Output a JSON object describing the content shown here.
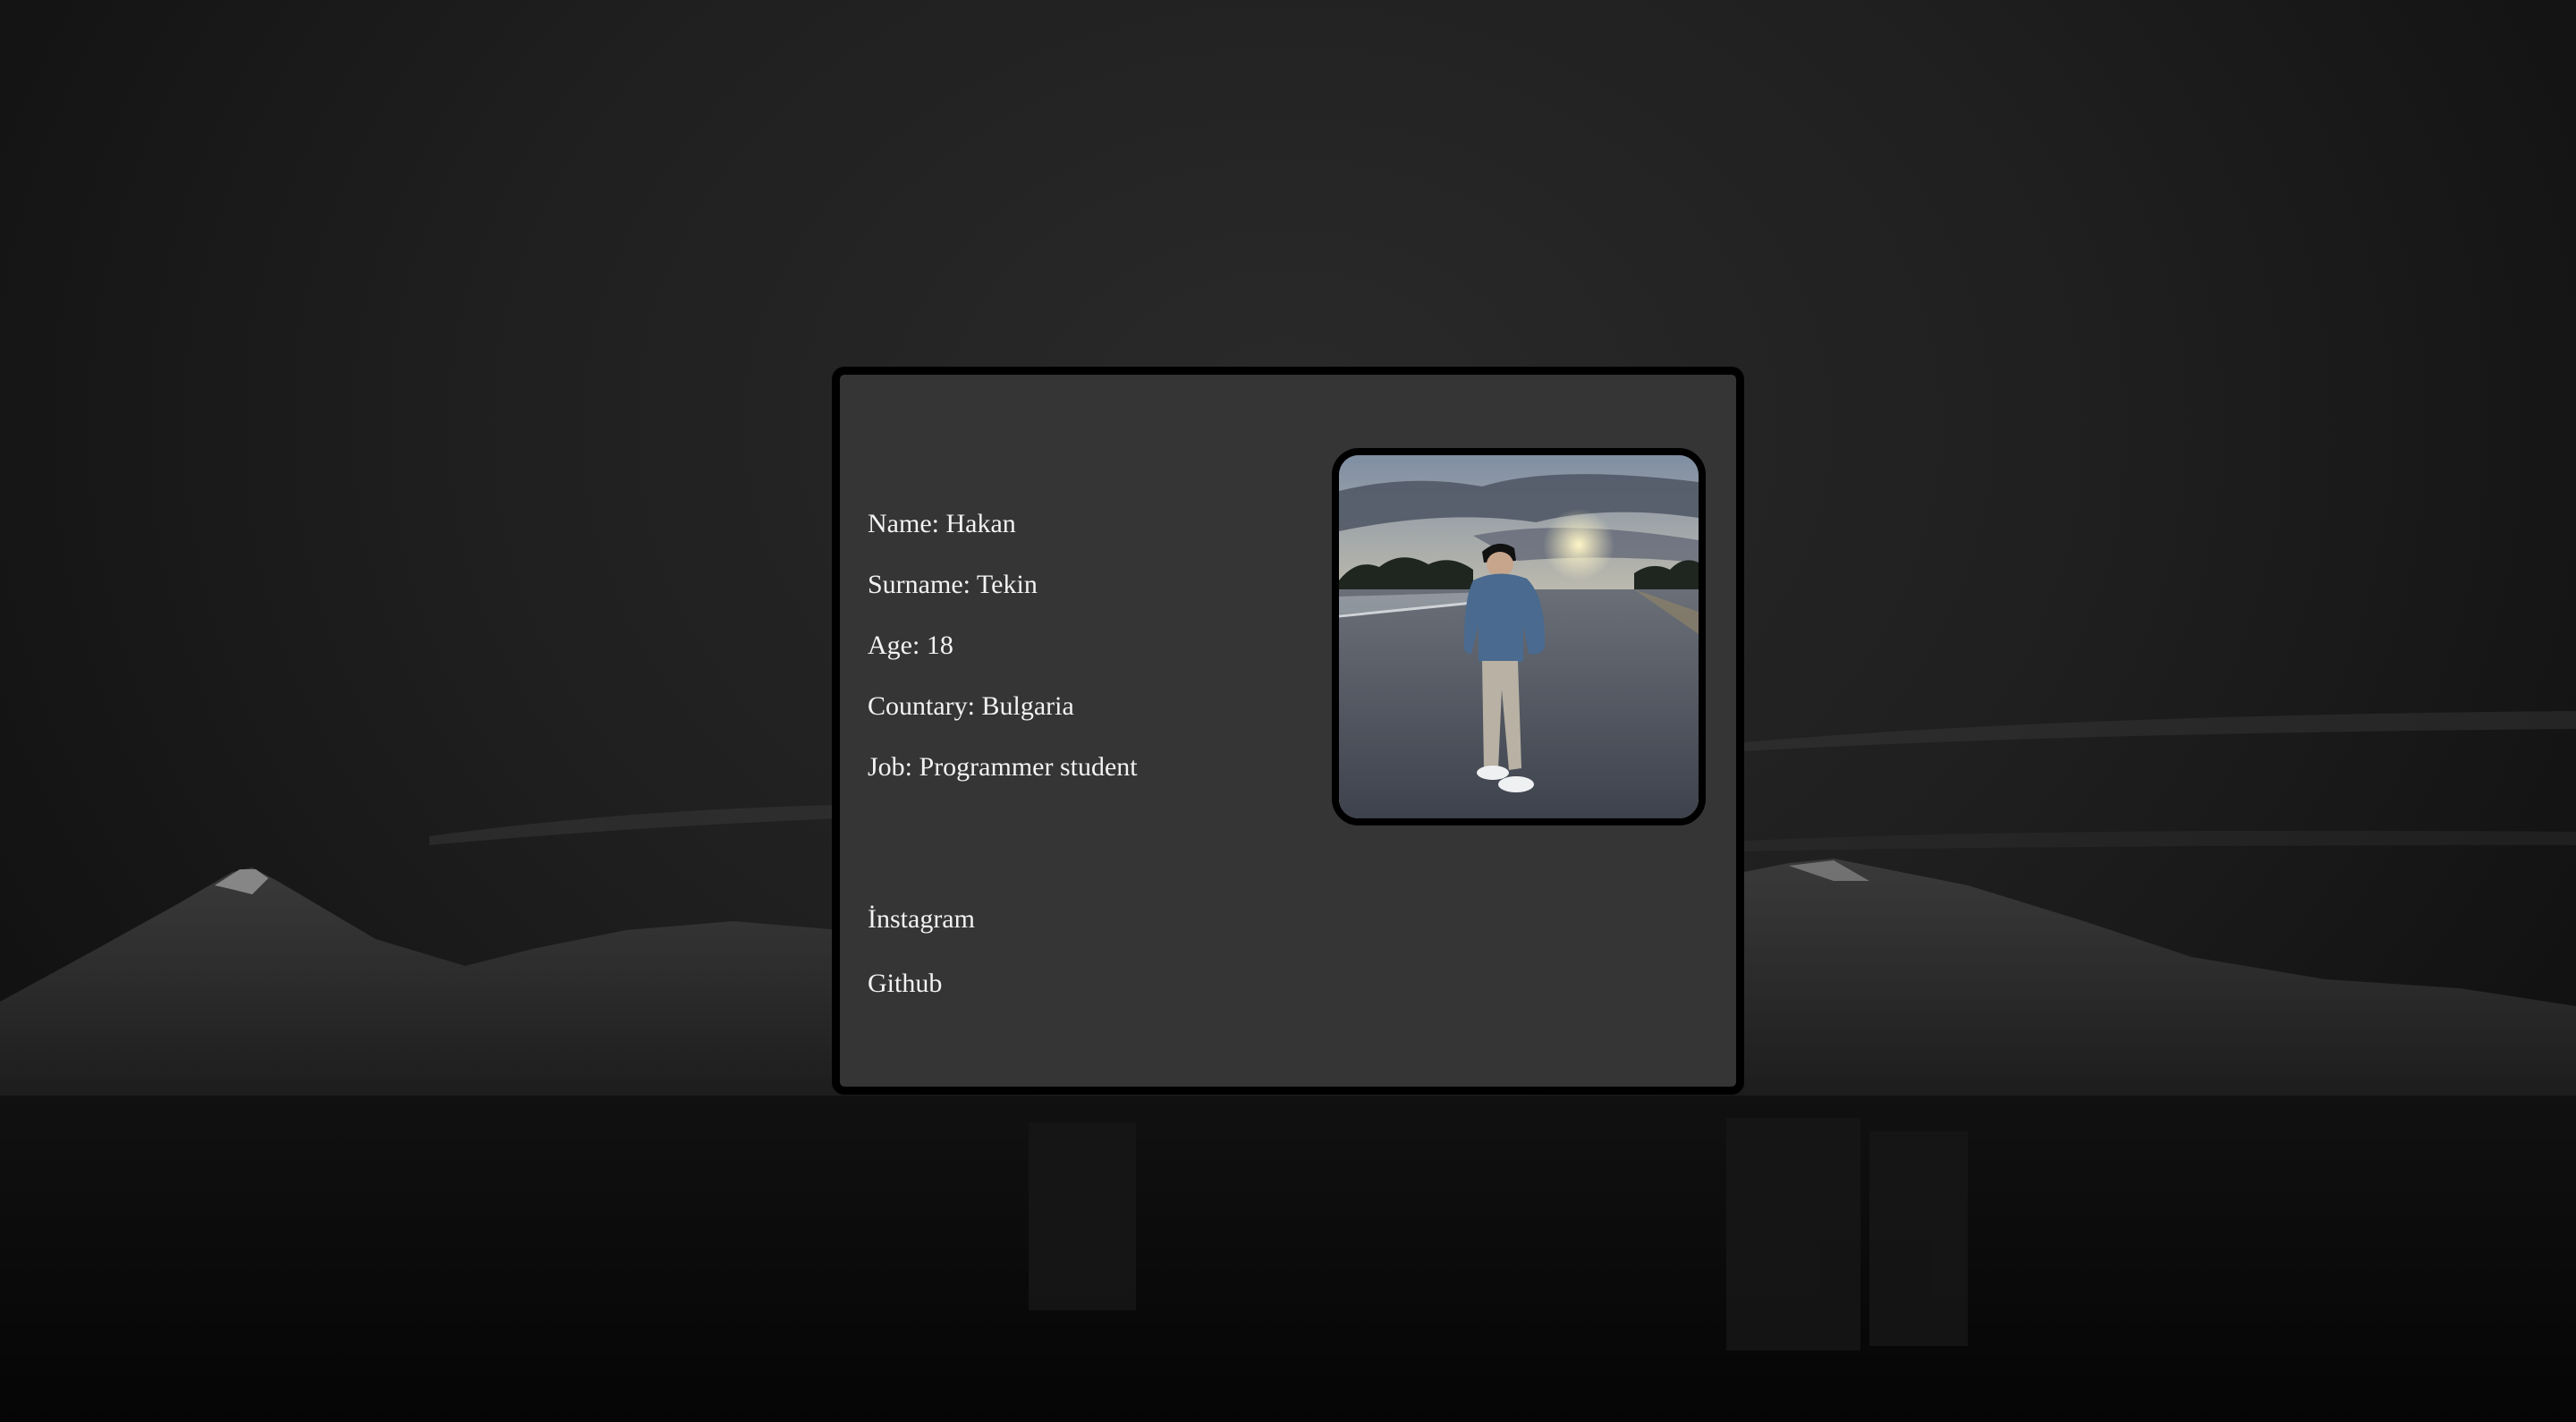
{
  "profile": {
    "name_line": "Name: Hakan",
    "surname_line": "Surname: Tekin",
    "age_line": "Age: 18",
    "country_line": "Countary: Bulgaria",
    "job_line": "Job: Programmer student"
  },
  "links": {
    "instagram_label": "İnstagram",
    "github_label": "Github"
  },
  "colors": {
    "card_background": "#353535",
    "card_border": "#000000",
    "text": "#f2f2f2"
  },
  "icons": {
    "profile_photo": "person-standing-on-road-photo",
    "background": "dark-mountain-landscape"
  }
}
